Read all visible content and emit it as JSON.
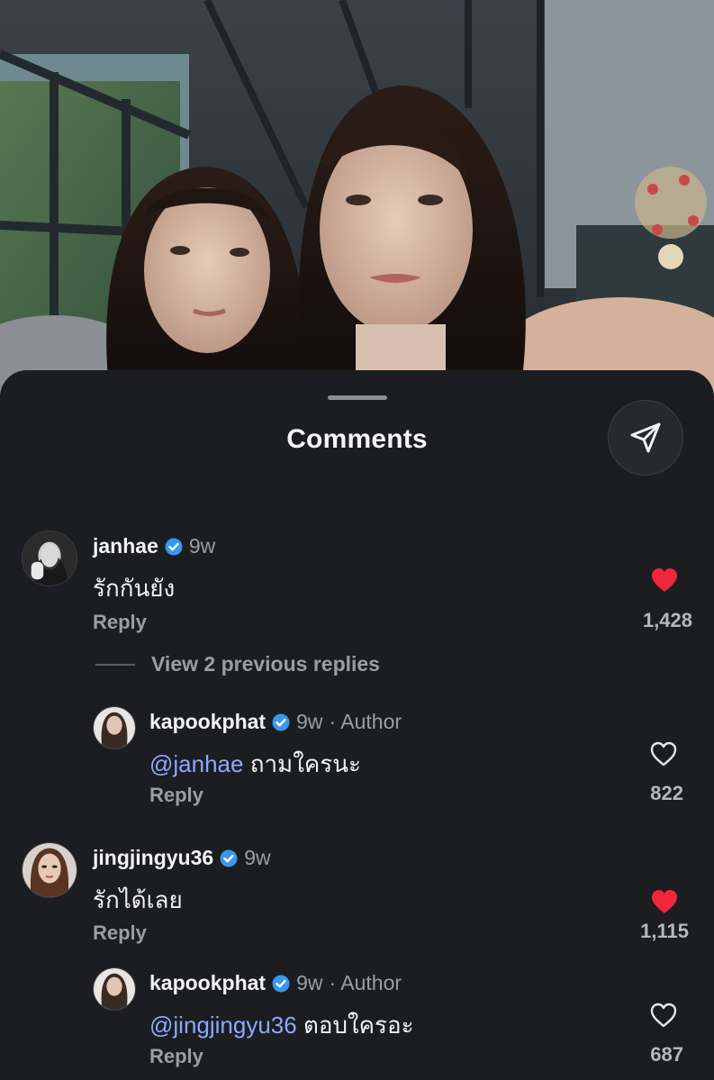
{
  "sheet": {
    "title": "Comments",
    "share_icon": "send-icon"
  },
  "colors": {
    "background": "#1b1d20",
    "like_red": "#f0263a",
    "mention": "#8ea7ff",
    "verified": "#3897f0"
  },
  "comments": [
    {
      "username": "janhae",
      "verified": true,
      "time": "9w",
      "author_tag": "",
      "mention": "",
      "text": "รักกันยัง",
      "reply_label": "Reply",
      "liked": true,
      "likes": "1,428"
    },
    {
      "username": "kapookphat",
      "verified": true,
      "time": "9w",
      "author_tag": "· Author",
      "mention": "@janhae",
      "text": " ถามใครนะ",
      "reply_label": "Reply",
      "liked": false,
      "likes": "822"
    },
    {
      "username": "jingjingyu36",
      "verified": true,
      "time": "9w",
      "author_tag": "",
      "mention": "",
      "text": "รักได้เลย",
      "reply_label": "Reply",
      "liked": true,
      "likes": "1,115"
    },
    {
      "username": "kapookphat",
      "verified": true,
      "time": "9w",
      "author_tag": "· Author",
      "mention": "@jingjingyu36",
      "text": " ตอบใครอะ",
      "reply_label": "Reply",
      "liked": false,
      "likes": "687"
    }
  ],
  "view_previous": "View 2 previous replies"
}
